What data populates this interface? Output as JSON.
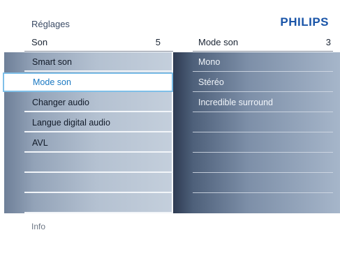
{
  "breadcrumb": "Réglages",
  "brand": "PHILIPS",
  "left_menu": {
    "title": "Son",
    "count": "5",
    "items": [
      {
        "label": "Smart son"
      },
      {
        "label": "Mode son",
        "selected": true
      },
      {
        "label": "Changer audio"
      },
      {
        "label": "Langue digital audio"
      },
      {
        "label": "AVL"
      },
      {
        "label": ""
      },
      {
        "label": ""
      },
      {
        "label": ""
      }
    ]
  },
  "right_menu": {
    "title": "Mode son",
    "count": "3",
    "items": [
      {
        "label": "Mono"
      },
      {
        "label": "Stéréo"
      },
      {
        "label": "Incredible surround"
      },
      {
        "label": ""
      },
      {
        "label": ""
      },
      {
        "label": ""
      },
      {
        "label": ""
      },
      {
        "label": ""
      }
    ]
  },
  "info_label": "Info",
  "colors": {
    "brand": "#1a55a8",
    "selection_text": "#1a78c2",
    "selection_border": "#7fbfe8"
  }
}
